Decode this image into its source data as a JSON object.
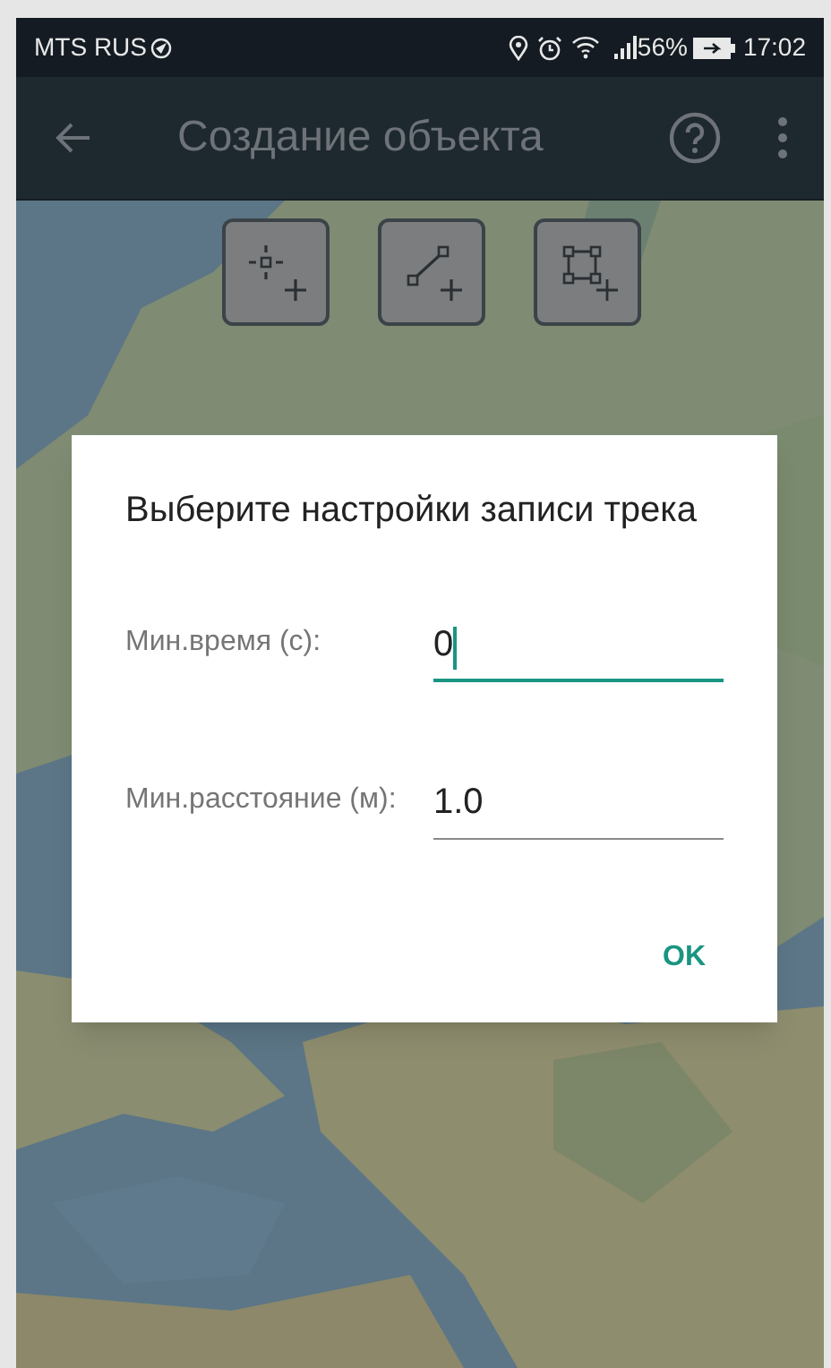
{
  "status_bar": {
    "carrier": "MTS RUS",
    "battery": "56%",
    "time": "17:02"
  },
  "toolbar": {
    "title": "Создание объекта"
  },
  "tools": [
    {
      "kind": "point"
    },
    {
      "kind": "line"
    },
    {
      "kind": "polygon"
    }
  ],
  "dialog": {
    "title": "Выберите настройки записи трека",
    "fields": [
      {
        "label": "Мин.время (с):",
        "value": "0",
        "focused": true
      },
      {
        "label": "Мин.расстояние (м):",
        "value": "1.0",
        "focused": false
      }
    ],
    "buttons": [
      "OK"
    ]
  }
}
